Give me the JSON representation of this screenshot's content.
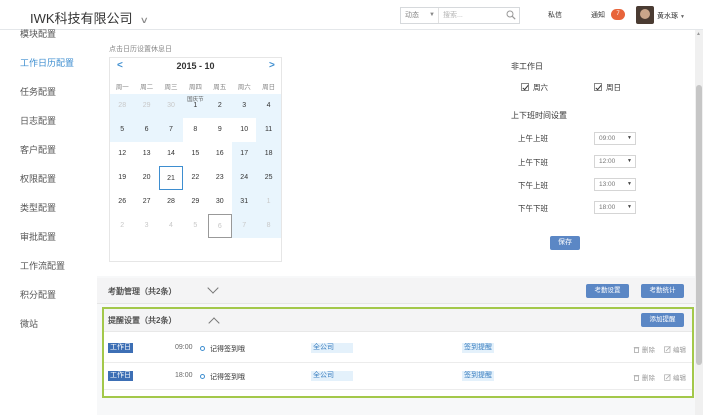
{
  "header": {
    "company": "IWK科技有限公司",
    "search_type": "动态",
    "search_placeholder": "搜索...",
    "nav_messages": "私信",
    "nav_notice": "通知",
    "notice_count": "7",
    "username": "黄水琢"
  },
  "sidebar": {
    "items": [
      {
        "label": "模块配置"
      },
      {
        "label": "工作日历配置",
        "active": true
      },
      {
        "label": "任务配置"
      },
      {
        "label": "日志配置"
      },
      {
        "label": "客户配置"
      },
      {
        "label": "权限配置"
      },
      {
        "label": "类型配置"
      },
      {
        "label": "审批配置"
      },
      {
        "label": "工作流配置"
      },
      {
        "label": "积分配置"
      },
      {
        "label": "微站"
      }
    ]
  },
  "calendar": {
    "hint": "点击日历设置休息日",
    "title": "2015 - 10",
    "prev": "<",
    "next": ">",
    "weekdays": [
      "周一",
      "周二",
      "周三",
      "周四",
      "周五",
      "周六",
      "周日"
    ],
    "weeks": [
      [
        {
          "d": "28",
          "o": true,
          "r": true
        },
        {
          "d": "29",
          "o": true,
          "r": true
        },
        {
          "d": "30",
          "o": true,
          "r": true
        },
        {
          "d": "1",
          "r": true,
          "f": "国庆节"
        },
        {
          "d": "2",
          "r": true
        },
        {
          "d": "3",
          "r": true
        },
        {
          "d": "4",
          "r": true
        }
      ],
      [
        {
          "d": "5",
          "r": true
        },
        {
          "d": "6",
          "r": true
        },
        {
          "d": "7",
          "r": true
        },
        {
          "d": "8"
        },
        {
          "d": "9"
        },
        {
          "d": "10"
        },
        {
          "d": "11",
          "r": true
        }
      ],
      [
        {
          "d": "12"
        },
        {
          "d": "13"
        },
        {
          "d": "14"
        },
        {
          "d": "15"
        },
        {
          "d": "16"
        },
        {
          "d": "17",
          "r": true
        },
        {
          "d": "18",
          "r": true
        }
      ],
      [
        {
          "d": "19"
        },
        {
          "d": "20"
        },
        {
          "d": "21",
          "t": true
        },
        {
          "d": "22"
        },
        {
          "d": "23"
        },
        {
          "d": "24",
          "r": true
        },
        {
          "d": "25",
          "r": true
        }
      ],
      [
        {
          "d": "26"
        },
        {
          "d": "27"
        },
        {
          "d": "28"
        },
        {
          "d": "29"
        },
        {
          "d": "30"
        },
        {
          "d": "31",
          "r": true
        },
        {
          "d": "1",
          "o": true,
          "r": true
        }
      ],
      [
        {
          "d": "2",
          "o": true
        },
        {
          "d": "3",
          "o": true
        },
        {
          "d": "4",
          "o": true
        },
        {
          "d": "5",
          "o": true
        },
        {
          "d": "6",
          "o": true,
          "s": true
        },
        {
          "d": "7",
          "o": true,
          "r": true
        },
        {
          "d": "8",
          "o": true,
          "r": true
        }
      ]
    ]
  },
  "settings": {
    "nonwork_title": "非工作日",
    "saturday": "周六",
    "sunday": "周日",
    "schedule_title": "上下班时间设置",
    "am_on_label": "上午上班",
    "am_on": "09:00",
    "am_off_label": "上午下班",
    "am_off": "12:00",
    "pm_on_label": "下午上班",
    "pm_on": "13:00",
    "pm_off_label": "下午下班",
    "pm_off": "18:00",
    "save": "保存"
  },
  "attendance": {
    "title": "考勤管理（共2条）",
    "btn_settings": "考勤设置",
    "btn_stats": "考勤统计"
  },
  "reminders": {
    "title": "提醒设置（共2条）",
    "add": "添加提醒",
    "delete": "删除",
    "edit": "编辑",
    "rows": [
      {
        "day": "工作日",
        "time": "09:00",
        "text": "记得签到哦",
        "scope": "全公司",
        "type": "签到提醒"
      },
      {
        "day": "工作日",
        "time": "18:00",
        "text": "记得签到哦",
        "scope": "全公司",
        "type": "签到提醒"
      }
    ]
  },
  "colors": {
    "accent": "#3e8ed0",
    "button": "#5b87c5",
    "highlight_border": "#a3c84a",
    "rest_day": "#e9f5fd",
    "badge": "#e8643a"
  }
}
